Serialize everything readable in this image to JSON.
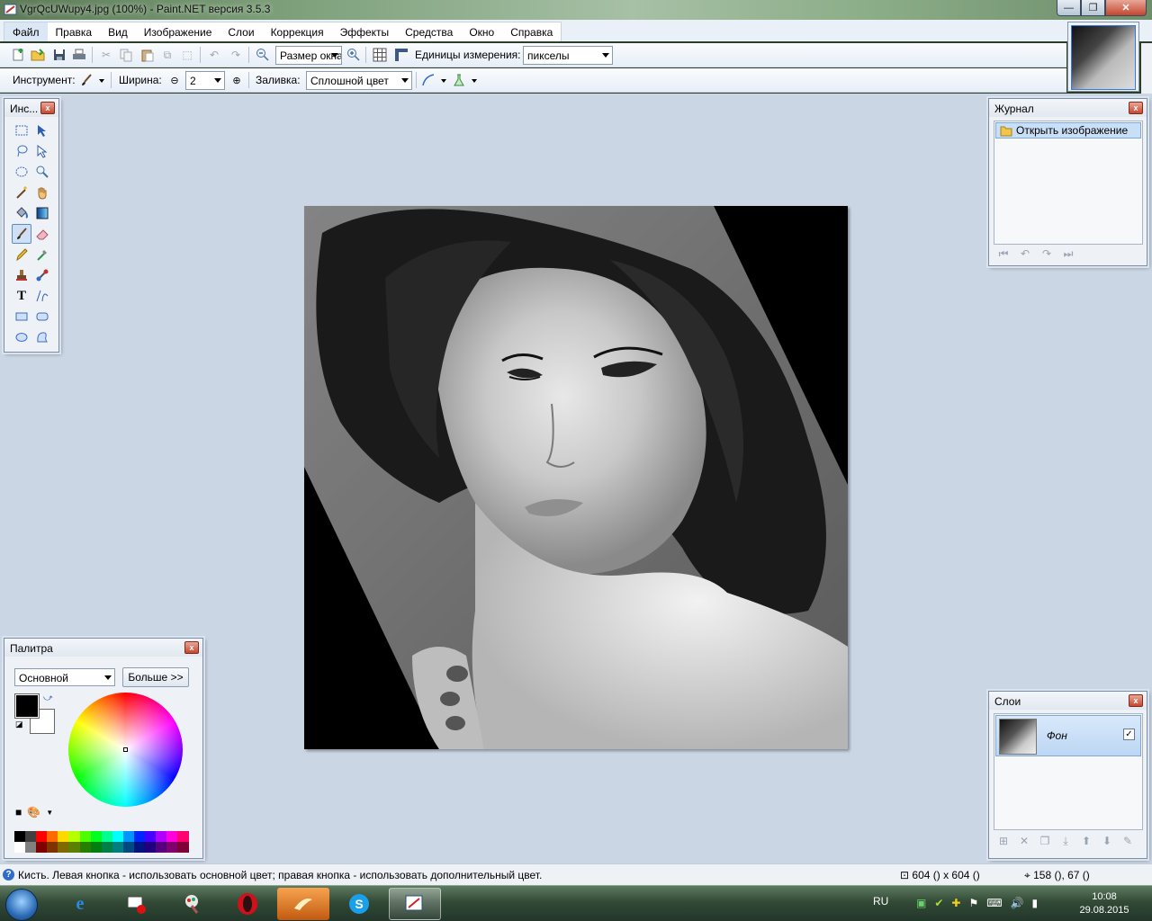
{
  "window": {
    "title": "VgrQcUWupy4.jpg (100%) - Paint.NET версия 3.5.3",
    "controls": [
      "—",
      "❐",
      "✕"
    ]
  },
  "menu": [
    "Файл",
    "Правка",
    "Вид",
    "Изображение",
    "Слои",
    "Коррекция",
    "Эффекты",
    "Средства",
    "Окно",
    "Справка"
  ],
  "toolbar": {
    "zoom_value": "Размер окна",
    "units_label": "Единицы измерения:",
    "units_value": "пикселы",
    "tool_label": "Инструмент:",
    "width_label": "Ширина:",
    "width_value": "2",
    "fill_label": "Заливка:",
    "fill_value": "Сплошной цвет"
  },
  "tools_panel": {
    "title": "Инс...",
    "close": "x",
    "icons": [
      "rectangle-select-icon",
      "move-selection-icon",
      "lasso-select-icon",
      "move-selected-icon",
      "ellipse-select-icon",
      "zoom-icon",
      "magic-wand-icon",
      "pan-icon",
      "paint-bucket-icon",
      "gradient-icon",
      "paintbrush-icon",
      "eraser-icon",
      "pencil-icon",
      "color-picker-icon",
      "clone-stamp-icon",
      "recolor-icon",
      "text-icon",
      "line-curve-icon",
      "rectangle-icon",
      "rounded-rectangle-icon",
      "ellipse-icon",
      "freeform-shape-icon"
    ]
  },
  "history_panel": {
    "title": "Журнал",
    "close": "x",
    "items": [
      "Открыть изображение"
    ]
  },
  "layers_panel": {
    "title": "Слои",
    "close": "x",
    "layers": [
      {
        "name": "Фон",
        "visible": true
      }
    ]
  },
  "palette_panel": {
    "title": "Палитра",
    "close": "x",
    "mode": "Основной",
    "more_button": "Больше >>",
    "primary_color": "#000000",
    "secondary_color": "#ffffff",
    "colors": [
      "#000000",
      "#404040",
      "#ff0000",
      "#ff6a00",
      "#ffd800",
      "#b6ff00",
      "#4cff00",
      "#00ff21",
      "#00ff90",
      "#00ffff",
      "#0094ff",
      "#0026ff",
      "#4800ff",
      "#b200ff",
      "#ff00dc",
      "#ff006e",
      "#ffffff",
      "#808080",
      "#7f0000",
      "#7f3300",
      "#7f6a00",
      "#5b7f00",
      "#267f00",
      "#007f0e",
      "#007f46",
      "#007f7f",
      "#004a7f",
      "#00137f",
      "#21007f",
      "#57007f",
      "#7f006e",
      "#7f0037"
    ]
  },
  "status": {
    "text": "Кисть. Левая кнопка - использовать основной цвет; правая кнопка - использовать дополнительный цвет.",
    "image_size": "604 () x 604 ()",
    "cursor": "158 (), 67 ()"
  },
  "taskbar": {
    "lang": "RU",
    "time": "10:08",
    "date": "29.08.2015"
  }
}
